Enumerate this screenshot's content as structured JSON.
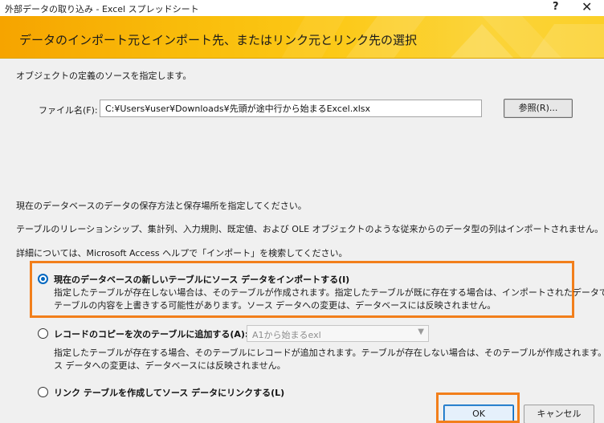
{
  "window": {
    "title": "外部データの取り込み - Excel スプレッドシート",
    "help_glyph": "?",
    "close_glyph": "✕"
  },
  "header": {
    "title": "データのインポート元とインポート先、またはリンク元とリンク先の選択"
  },
  "source": {
    "prompt": "オブジェクトの定義のソースを指定します。",
    "file_label": "ファイル名(F):",
    "file_value": "C:¥Users¥user¥Downloads¥先頭が途中行から始まるExcel.xlsx",
    "browse_label": "参照(R)..."
  },
  "storage": {
    "prompt": "現在のデータベースのデータの保存方法と保存場所を指定してください。",
    "note1": "テーブルのリレーションシップ、集計列、入力規則、既定値、および OLE オブジェクトのような従来からのデータ型の列はインポートされません。",
    "note2": "詳細については、Microsoft Access ヘルプで「インポート」を検索してください。"
  },
  "options": [
    {
      "label": "現在のデータベースの新しいテーブルにソース データをインポートする(I)",
      "selected": true,
      "desc_line1": "指定したテーブルが存在しない場合は、そのテーブルが作成されます。指定したテーブルが既に存在する場合は、インポートされたデータで",
      "desc_line2": "テーブルの内容を上書きする可能性があります。ソース データへの変更は、データベースには反映されません。"
    },
    {
      "label": "レコードのコピーを次のテーブルに追加する(A):",
      "selected": false,
      "combo_value": "A1から始まるexl",
      "desc_line1": "指定したテーブルが存在する場合、そのテーブルにレコードが追加されます。テーブルが存在しない場合は、そのテーブルが作成されます。ソー",
      "desc_line2": "ス データへの変更は、データベースには反映されません。"
    },
    {
      "label": "リンク テーブルを作成してソース データにリンクする(L)",
      "selected": false
    }
  ],
  "footer": {
    "ok_label": "OK",
    "cancel_label": "キャンセル"
  },
  "colors": {
    "banner": "#f9bc0a",
    "highlight": "#f27f1b",
    "accent": "#0067c0"
  }
}
